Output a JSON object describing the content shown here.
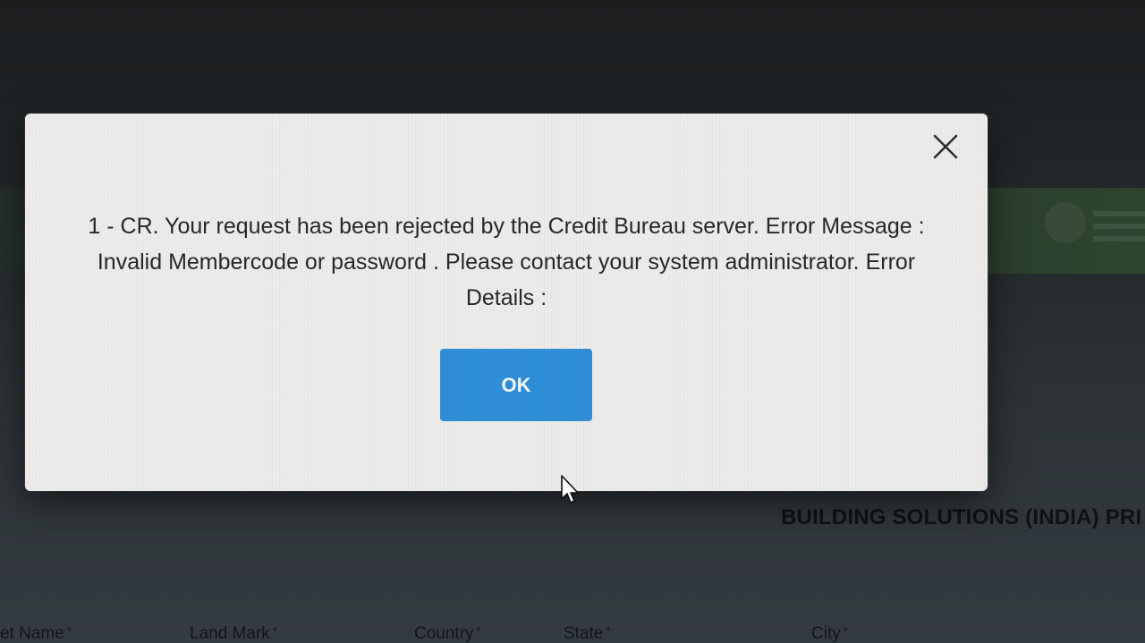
{
  "background": {
    "company_name": "BUILDING SOLUTIONS (INDIA) PRI",
    "form_labels": [
      {
        "label": "et Name",
        "required": "*"
      },
      {
        "label": "Land Mark",
        "required": "*"
      },
      {
        "label": "Country",
        "required": "*"
      },
      {
        "label": "State",
        "required": "*"
      },
      {
        "label": "City",
        "required": "*"
      }
    ]
  },
  "dialog": {
    "close_icon": "close-icon",
    "message": "1 - CR. Your request has been rejected by the Credit Bureau server. Error Message : Invalid Membercode or password . Please contact your system administrator. Error Details :",
    "ok_label": "OK"
  },
  "colors": {
    "dialog_background": "#ecebea",
    "ok_button": "#2f8ed8",
    "message_text": "#25282b"
  }
}
